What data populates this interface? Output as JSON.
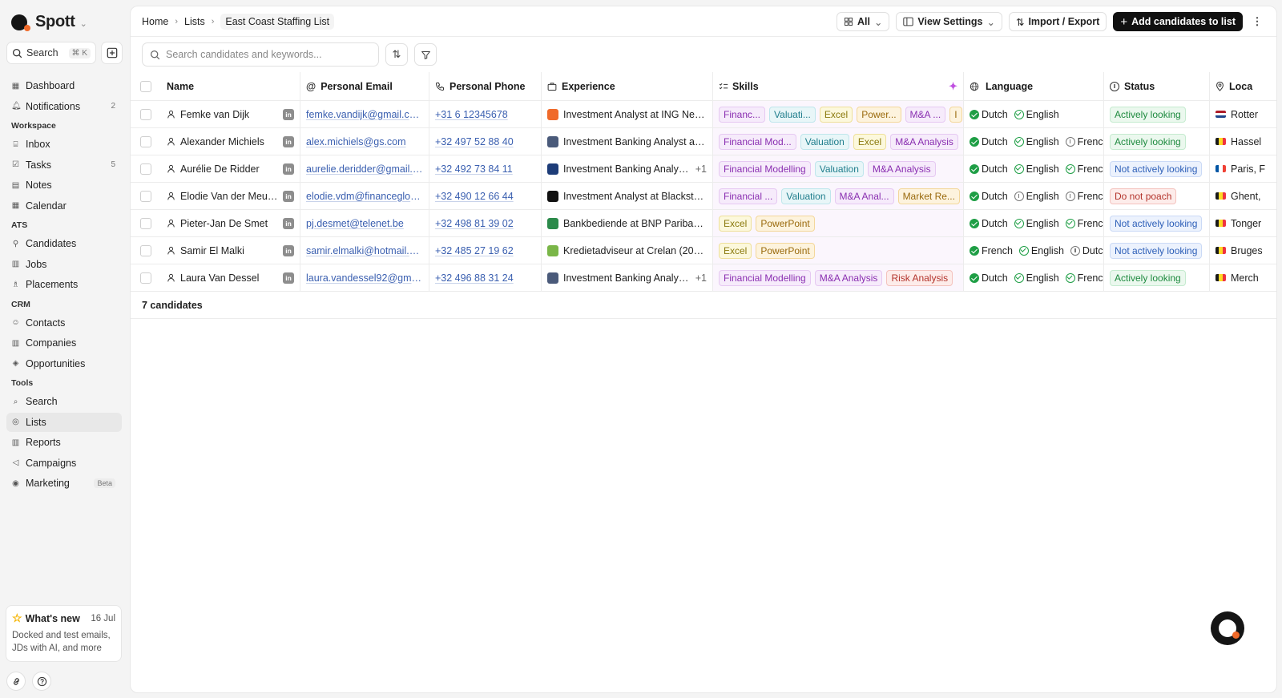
{
  "app": {
    "name": "Spott"
  },
  "sidebar": {
    "search_label": "Search",
    "search_shortcut": "⌘ K",
    "top_items": [
      {
        "label": "Dashboard",
        "icon": "grid-icon"
      },
      {
        "label": "Notifications",
        "icon": "bell-icon",
        "count": "2"
      }
    ],
    "sections": {
      "workspace": "Workspace",
      "ats": "ATS",
      "crm": "CRM",
      "tools": "Tools"
    },
    "workspace_items": [
      {
        "label": "Inbox",
        "icon": "inbox-icon"
      },
      {
        "label": "Tasks",
        "icon": "task-icon",
        "count": "5"
      },
      {
        "label": "Notes",
        "icon": "note-icon"
      },
      {
        "label": "Calendar",
        "icon": "calendar-icon"
      }
    ],
    "ats_items": [
      {
        "label": "Candidates",
        "icon": "person-icon"
      },
      {
        "label": "Jobs",
        "icon": "jobs-icon"
      },
      {
        "label": "Placements",
        "icon": "placement-icon"
      }
    ],
    "crm_items": [
      {
        "label": "Contacts",
        "icon": "contact-icon"
      },
      {
        "label": "Companies",
        "icon": "building-icon"
      },
      {
        "label": "Opportunities",
        "icon": "opportunity-icon"
      }
    ],
    "tools_items": [
      {
        "label": "Search",
        "icon": "search-icon"
      },
      {
        "label": "Lists",
        "icon": "list-icon",
        "active": true
      },
      {
        "label": "Reports",
        "icon": "chart-icon"
      },
      {
        "label": "Campaigns",
        "icon": "megaphone-icon"
      },
      {
        "label": "Marketing",
        "icon": "target-icon",
        "badge": "Beta"
      }
    ],
    "whats_new": {
      "title": "What's new",
      "date": "16 Jul",
      "body": "Docked and test emails, JDs with AI, and more"
    }
  },
  "breadcrumb": {
    "home": "Home",
    "lists": "Lists",
    "current": "East Coast Staffing List"
  },
  "toolbar": {
    "view_filter": "All",
    "view_settings": "View Settings",
    "import_export": "Import / Export",
    "add_candidates": "Add candidates to list"
  },
  "search": {
    "placeholder": "Search candidates and keywords..."
  },
  "table": {
    "columns": {
      "name": "Name",
      "email": "Personal Email",
      "phone": "Personal Phone",
      "experience": "Experience",
      "skills": "Skills",
      "language": "Language",
      "status": "Status",
      "location": "Loca"
    },
    "rows": [
      {
        "name": "Femke van Dijk",
        "email": "femke.vandijk@gmail.com",
        "phone": "+31 6 12345678",
        "experience": "Investment Analyst at ING Nede...",
        "experience_extra": "",
        "skills": [
          [
            "Financ...",
            "purple"
          ],
          [
            "Valuati...",
            "teal"
          ],
          [
            "Excel",
            "yellow"
          ],
          [
            "Power...",
            "orange"
          ],
          [
            "M&A ...",
            "purple"
          ],
          [
            "I",
            "orange"
          ]
        ],
        "languages": [
          [
            "Dutch",
            "full"
          ],
          [
            "English",
            "partial"
          ]
        ],
        "status": [
          "Actively looking",
          "green"
        ],
        "location": "Rotter",
        "flag": [
          "#ae1c28",
          "#ffffff",
          "#21468b"
        ]
      },
      {
        "name": "Alexander Michiels",
        "email": "alex.michiels@gs.com",
        "phone": "+32 497 52 88 40",
        "experience": "Investment Banking Analyst at ...",
        "experience_extra": "",
        "skills": [
          [
            "Financial Mod...",
            "purple"
          ],
          [
            "Valuation",
            "teal"
          ],
          [
            "Excel",
            "yellow"
          ],
          [
            "M&A Analysis",
            "purple"
          ]
        ],
        "languages": [
          [
            "Dutch",
            "full"
          ],
          [
            "English",
            "partial"
          ],
          [
            "Frenc",
            "info"
          ]
        ],
        "status": [
          "Actively looking",
          "green"
        ],
        "location": "Hassel",
        "flag": [
          "#1a1a1a",
          "#fdda24",
          "#ef3340"
        ]
      },
      {
        "name": "Aurélie De Ridder",
        "email": "aurelie.deridder@gmail.c...",
        "phone": "+32 492 73 84 11",
        "experience": "Investment Banking Analys...",
        "experience_extra": "+1",
        "skills": [
          [
            "Financial Modelling",
            "purple"
          ],
          [
            "Valuation",
            "teal"
          ],
          [
            "M&A Analysis",
            "purple"
          ]
        ],
        "languages": [
          [
            "Dutch",
            "full"
          ],
          [
            "English",
            "partial"
          ],
          [
            "Frenc",
            "partial"
          ]
        ],
        "status": [
          "Not actively looking",
          "blue"
        ],
        "location": "Paris, F",
        "flag": [
          "#0055a4",
          "#ffffff",
          "#ef4135"
        ]
      },
      {
        "name": "Elodie Van der Meulen",
        "email": "elodie.vdm@financeglob...",
        "phone": "+32 490 12 66 44",
        "experience": "Investment Analyst at Blackston...",
        "experience_extra": "",
        "skills": [
          [
            "Financial ...",
            "purple"
          ],
          [
            "Valuation",
            "teal"
          ],
          [
            "M&A Anal...",
            "purple"
          ],
          [
            "Market Re...",
            "orange"
          ]
        ],
        "languages": [
          [
            "Dutch",
            "full"
          ],
          [
            "English",
            "info"
          ],
          [
            "Frenc",
            "info"
          ]
        ],
        "status": [
          "Do not poach",
          "red"
        ],
        "location": "Ghent,",
        "flag": [
          "#1a1a1a",
          "#fdda24",
          "#ef3340"
        ]
      },
      {
        "name": "Pieter-Jan De Smet",
        "email": "pj.desmet@telenet.be",
        "phone": "+32 498 81 39 02",
        "experience": "Bankbediende at BNP Paribas (...",
        "experience_extra": "",
        "skills": [
          [
            "Excel",
            "yellow"
          ],
          [
            "PowerPoint",
            "orange"
          ]
        ],
        "languages": [
          [
            "Dutch",
            "full"
          ],
          [
            "English",
            "partial"
          ],
          [
            "Frenc",
            "partial"
          ]
        ],
        "status": [
          "Not actively looking",
          "blue"
        ],
        "location": "Tonger",
        "flag": [
          "#1a1a1a",
          "#fdda24",
          "#ef3340"
        ]
      },
      {
        "name": "Samir El Malki",
        "email": "samir.elmalki@hotmail.com",
        "phone": "+32 485 27 19 62",
        "experience": "Kredietadviseur at Crelan (2018 ...",
        "experience_extra": "",
        "skills": [
          [
            "Excel",
            "yellow"
          ],
          [
            "PowerPoint",
            "orange"
          ]
        ],
        "languages": [
          [
            "French",
            "full"
          ],
          [
            "English",
            "partial"
          ],
          [
            "Dutc",
            "info"
          ]
        ],
        "status": [
          "Not actively looking",
          "blue"
        ],
        "location": "Bruges",
        "flag": [
          "#1a1a1a",
          "#fdda24",
          "#ef3340"
        ]
      },
      {
        "name": "Laura Van Dessel",
        "email": "laura.vandessel92@gmail...",
        "phone": "+32 496 88 31 24",
        "experience": "Investment Banking Analys...",
        "experience_extra": "+1",
        "skills": [
          [
            "Financial Modelling",
            "purple"
          ],
          [
            "M&A Analysis",
            "purple"
          ],
          [
            "Risk Analysis",
            "red"
          ]
        ],
        "languages": [
          [
            "Dutch",
            "full"
          ],
          [
            "English",
            "partial"
          ],
          [
            "Frenc",
            "partial"
          ]
        ],
        "status": [
          "Actively looking",
          "green"
        ],
        "location": "Merch",
        "flag": [
          "#1a1a1a",
          "#fdda24",
          "#ef3340"
        ]
      }
    ],
    "count_label": "7 candidates",
    "experience_icon_colors": [
      "#f06a2a",
      "#4a5a7a",
      "#1d3c78",
      "#111111",
      "#2b8a4a",
      "#7ab648",
      "#4a5a7a"
    ]
  }
}
